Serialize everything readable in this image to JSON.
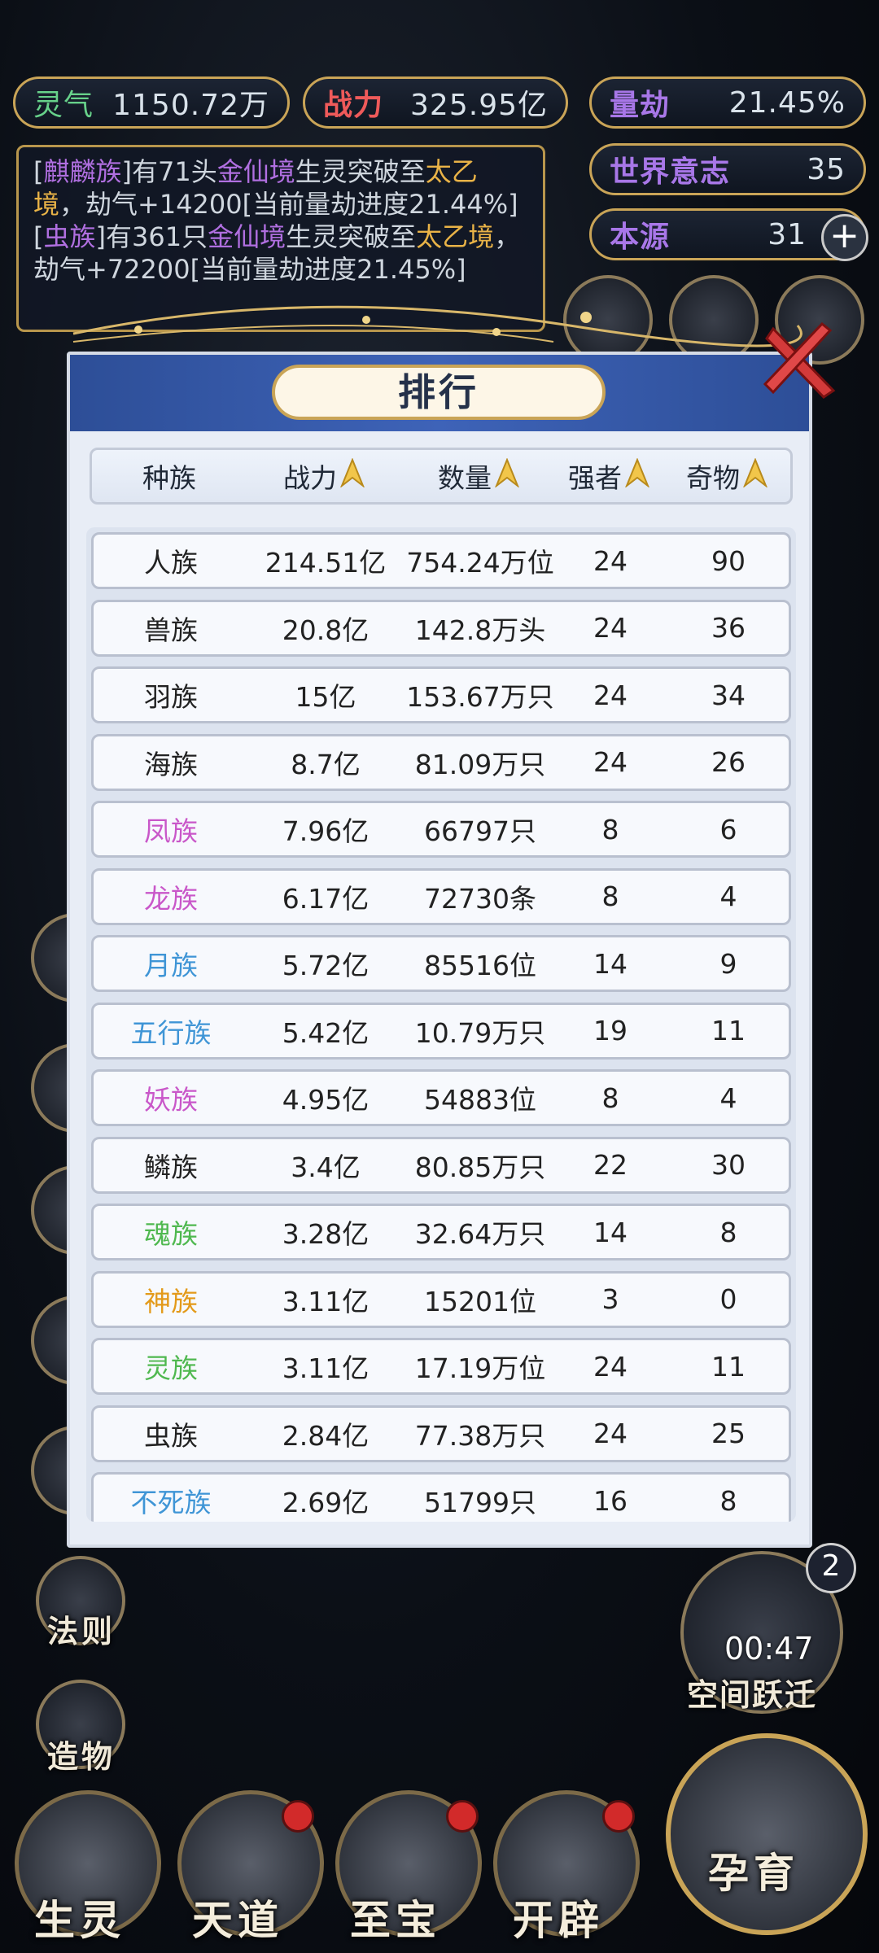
{
  "hud": {
    "lingqi": {
      "label": "灵气",
      "value": "1150.72万"
    },
    "zhanli": {
      "label": "战力",
      "value": "325.95亿"
    },
    "liangjie": {
      "label": "量劫",
      "value": "21.45%"
    },
    "shijie": {
      "label": "世界意志",
      "value": "35"
    },
    "benyuan": {
      "label": "本源",
      "value": "31"
    }
  },
  "log": {
    "entry1": {
      "b1": "[",
      "race": "麒麟族",
      "t1": "]有71头",
      "realm1": "金仙境",
      "t2": "生灵突破至",
      "realm2": "太乙境",
      "t3": "，劫气+14200[当前量劫进度21.44%]"
    },
    "entry2": {
      "b1": "[",
      "race": "虫族",
      "t1": "]有361只",
      "realm1": "金仙境",
      "t2": "生灵突破至",
      "realm2": "太乙境",
      "t3": "，劫气+72200[当前量劫进度21.45%]"
    }
  },
  "modal": {
    "title": "排行",
    "headers": {
      "race": "种族",
      "power": "战力",
      "count": "数量",
      "strong": "强者",
      "treasure": "奇物"
    },
    "rows": [
      {
        "race": "人族",
        "power": "214.51亿",
        "count": "754.24万位",
        "strong": "24",
        "treasure": "90",
        "color": "#222222"
      },
      {
        "race": "兽族",
        "power": "20.8亿",
        "count": "142.8万头",
        "strong": "24",
        "treasure": "36",
        "color": "#222222"
      },
      {
        "race": "羽族",
        "power": "15亿",
        "count": "153.67万只",
        "strong": "24",
        "treasure": "34",
        "color": "#222222"
      },
      {
        "race": "海族",
        "power": "8.7亿",
        "count": "81.09万只",
        "strong": "24",
        "treasure": "26",
        "color": "#222222"
      },
      {
        "race": "凤族",
        "power": "7.96亿",
        "count": "66797只",
        "strong": "8",
        "treasure": "6",
        "color": "#c957c9"
      },
      {
        "race": "龙族",
        "power": "6.17亿",
        "count": "72730条",
        "strong": "8",
        "treasure": "4",
        "color": "#c957c9"
      },
      {
        "race": "月族",
        "power": "5.72亿",
        "count": "85516位",
        "strong": "14",
        "treasure": "9",
        "color": "#3f95d6"
      },
      {
        "race": "五行族",
        "power": "5.42亿",
        "count": "10.79万只",
        "strong": "19",
        "treasure": "11",
        "color": "#3f95d6"
      },
      {
        "race": "妖族",
        "power": "4.95亿",
        "count": "54883位",
        "strong": "8",
        "treasure": "4",
        "color": "#c957c9"
      },
      {
        "race": "鳞族",
        "power": "3.4亿",
        "count": "80.85万只",
        "strong": "22",
        "treasure": "30",
        "color": "#222222"
      },
      {
        "race": "魂族",
        "power": "3.28亿",
        "count": "32.64万只",
        "strong": "14",
        "treasure": "8",
        "color": "#4fb84f"
      },
      {
        "race": "神族",
        "power": "3.11亿",
        "count": "15201位",
        "strong": "3",
        "treasure": "0",
        "color": "#e39a1a"
      },
      {
        "race": "灵族",
        "power": "3.11亿",
        "count": "17.19万位",
        "strong": "24",
        "treasure": "11",
        "color": "#4fb84f"
      },
      {
        "race": "虫族",
        "power": "2.84亿",
        "count": "77.38万只",
        "strong": "24",
        "treasure": "25",
        "color": "#222222"
      },
      {
        "race": "不死族",
        "power": "2.69亿",
        "count": "51799只",
        "strong": "16",
        "treasure": "8",
        "color": "#3f95d6"
      }
    ]
  },
  "side": {
    "fazi": "法则",
    "zaowu": "造物",
    "timer": "00:47",
    "kongjian": "空间跃迁",
    "badge": "2"
  },
  "bottom": {
    "shengling": "生灵",
    "tiandao": "天道",
    "zhibao": "至宝",
    "kaipi": "开辟",
    "yunyu": "孕育"
  }
}
